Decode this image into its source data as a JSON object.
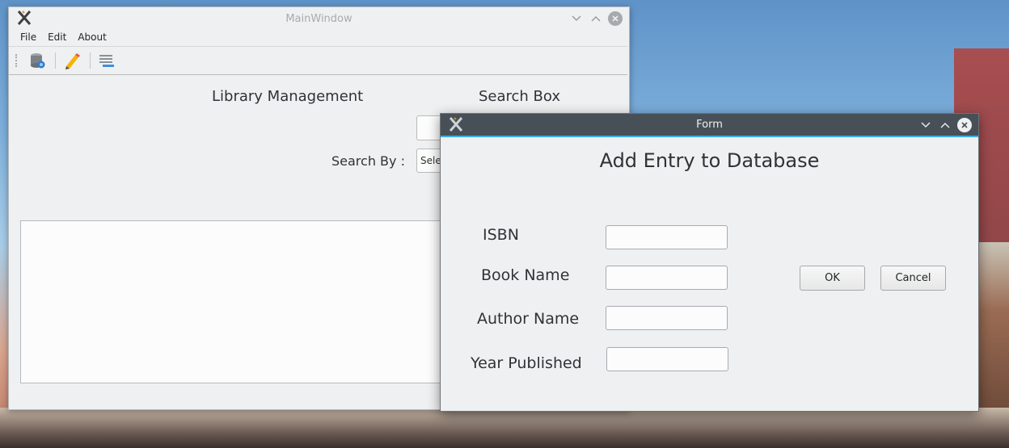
{
  "main_window": {
    "title": "MainWindow",
    "menu": [
      "File",
      "Edit",
      "About"
    ],
    "toolbar_icons": [
      "database-icon",
      "pencil-icon",
      "list-icon"
    ],
    "heading_left": "Library Management",
    "heading_right": "Search Box",
    "search_by_label": "Search By :",
    "search_by_value": "Sele"
  },
  "form": {
    "title": "Form",
    "heading": "Add Entry to Database",
    "fields": [
      {
        "label": "ISBN",
        "value": ""
      },
      {
        "label": "Book Name",
        "value": ""
      },
      {
        "label": "Author Name",
        "value": ""
      },
      {
        "label": "Year Published",
        "value": ""
      }
    ],
    "ok_label": "OK",
    "cancel_label": "Cancel"
  },
  "colors": {
    "accent": "#3daee9",
    "dialog_titlebar": "#475057"
  }
}
